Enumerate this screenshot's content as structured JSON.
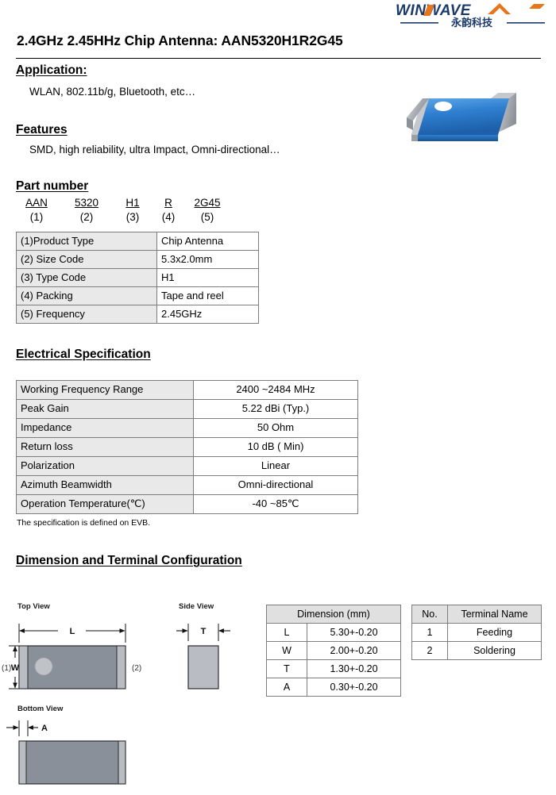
{
  "logo": {
    "wordmark": "WINWAVE",
    "chinese": "永韵科技",
    "colors": {
      "navy": "#1b3a6b",
      "orange": "#e8751a"
    }
  },
  "title": "2.4GHz 2.45HHz Chip Antenna: AAN5320H1R2G45",
  "sections": {
    "application": {
      "heading": "Application:",
      "text": "WLAN, 802.11b/g, Bluetooth, etc…"
    },
    "features": {
      "heading": "Features",
      "text": "SMD, high reliability, ultra Impact, Omni-directional…"
    },
    "part_number": {
      "heading": "Part number"
    },
    "electrical": {
      "heading": "Electrical Specification",
      "note": "The specification is defined on EVB."
    },
    "dimension": {
      "heading": "Dimension and Terminal Configuration"
    }
  },
  "part_number_codes": [
    {
      "code": "AAN",
      "index": "(1)"
    },
    {
      "code": "5320",
      "index": "(2)"
    },
    {
      "code": "H1",
      "index": "(3)"
    },
    {
      "code": "R",
      "index": "(4)"
    },
    {
      "code": "2G45",
      "index": "(5)"
    }
  ],
  "part_number_table": [
    {
      "key": "(1)Product Type",
      "value": "Chip Antenna"
    },
    {
      "key": "(2) Size Code",
      "value": "5.3x2.0mm"
    },
    {
      "key": "(3) Type Code",
      "value": "H1"
    },
    {
      "key": "(4) Packing",
      "value": "Tape and reel"
    },
    {
      "key": "(5) Frequency",
      "value": "2.45GHz"
    }
  ],
  "electrical_table": [
    {
      "key": "Working Frequency Range",
      "value": "2400 ~2484 MHz"
    },
    {
      "key": "Peak Gain",
      "value": "5.22 dBi (Typ.)"
    },
    {
      "key": "Impedance",
      "value": "50 Ohm"
    },
    {
      "key": "Return loss",
      "value": "10 dB ( Min)"
    },
    {
      "key": "Polarization",
      "value": "Linear"
    },
    {
      "key": "Azimuth Beamwidth",
      "value": "Omni-directional"
    },
    {
      "key": "Operation Temperature(℃)",
      "value": "-40 ~85℃"
    }
  ],
  "dimension_table": {
    "header": "Dimension (mm)",
    "rows": [
      {
        "symbol": "L",
        "value": "5.30+-0.20"
      },
      {
        "symbol": "W",
        "value": "2.00+-0.20"
      },
      {
        "symbol": "T",
        "value": "1.30+-0.20"
      },
      {
        "symbol": "A",
        "value": "0.30+-0.20"
      }
    ]
  },
  "terminal_table": {
    "headers": {
      "no": "No.",
      "name": "Terminal Name"
    },
    "rows": [
      {
        "no": "1",
        "name": "Feeding"
      },
      {
        "no": "2",
        "name": "Soldering"
      }
    ]
  },
  "drawings": {
    "top_view": {
      "title": "Top View",
      "dim_length": "L",
      "dim_width": "W",
      "pin_left": "(1)",
      "pin_right": "(2)"
    },
    "side_view": {
      "title": "Side View",
      "dim_thickness": "T"
    },
    "bottom_view": {
      "title": "Bottom View",
      "dim_band": "A"
    },
    "colors": {
      "body": "#8a9099",
      "terminal": "#b9bdc3",
      "pad": "#bfc3c8",
      "outline": "#2b2b2b"
    }
  }
}
